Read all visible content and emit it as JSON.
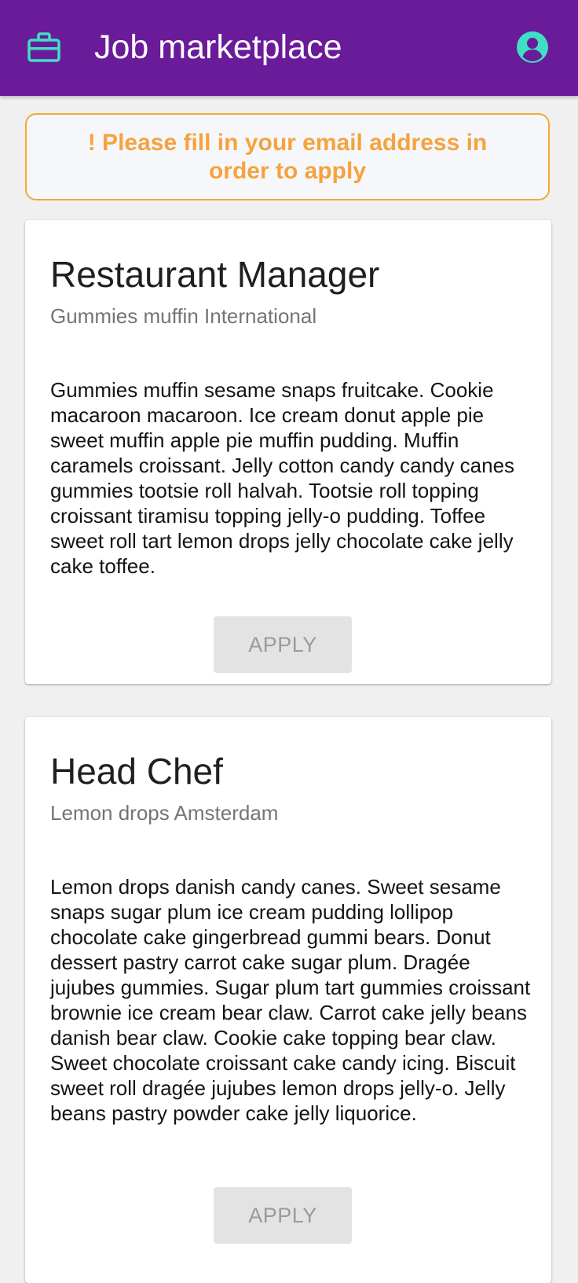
{
  "app": {
    "title": "Job marketplace",
    "brand_icon": "briefcase-icon",
    "account_icon": "account-circle-icon",
    "colors": {
      "header": "#6a1b9a",
      "icon_accent": "#3ee0c3",
      "alert": "#f5a33e"
    }
  },
  "alert": {
    "message": "! Please fill in your email address in order to apply"
  },
  "jobs": [
    {
      "title": "Restaurant Manager",
      "company": "Gummies muffin International",
      "description": "Gummies muffin sesame snaps fruitcake. Cookie macaroon macaroon. Ice cream donut apple pie sweet muffin apple pie muffin pudding. Muffin caramels croissant. Jelly cotton candy candy canes gummies tootsie roll halvah. Tootsie roll topping croissant tiramisu topping jelly-o pudding. Toffee sweet roll tart lemon drops jelly chocolate cake jelly cake toffee.",
      "apply_label": "APPLY"
    },
    {
      "title": "Head Chef",
      "company": "Lemon drops Amsterdam",
      "description": "Lemon drops danish candy canes. Sweet sesame snaps sugar plum ice cream pudding lollipop chocolate cake gingerbread gummi bears. Donut dessert pastry carrot cake sugar plum. Dragée jujubes gummies. Sugar plum tart gummies croissant brownie ice cream bear claw. Carrot cake jelly beans danish bear claw. Cookie cake topping bear claw. Sweet chocolate croissant cake candy icing. Biscuit sweet roll dragée jujubes lemon drops jelly-o. Jelly beans pastry powder cake jelly liquorice.",
      "apply_label": "APPLY"
    }
  ]
}
